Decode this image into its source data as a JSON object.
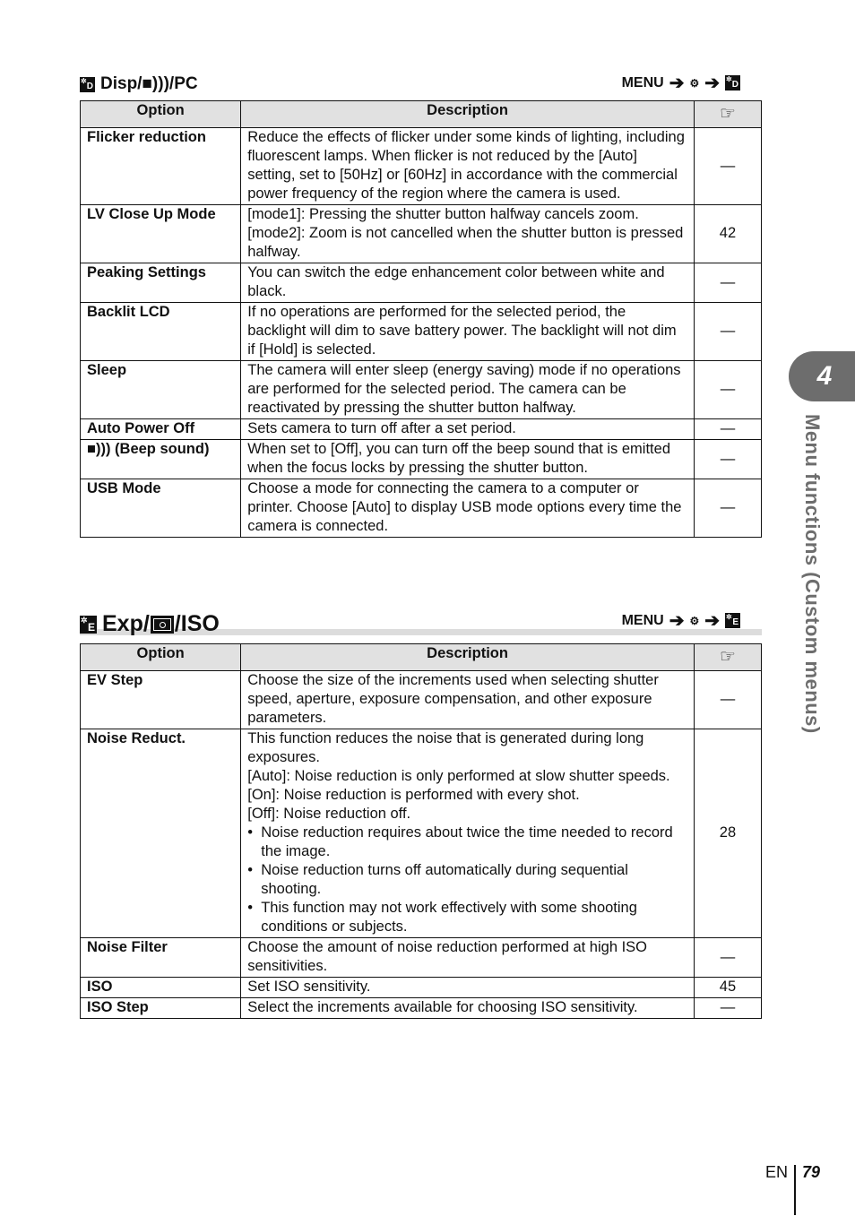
{
  "section1": {
    "title": "Disp/■)))/PC",
    "icon": "custom-menu-d-icon",
    "menu_path": {
      "menu": "MENU",
      "arrow": "➔",
      "gear": "⚙",
      "icon_letter": "D"
    },
    "headers": {
      "option": "Option",
      "description": "Description",
      "ref": "☞"
    },
    "rows": [
      {
        "option": "Flicker reduction",
        "description": [
          "Reduce the effects of flicker under some kinds of lighting, including fluorescent lamps. When flicker is not reduced by the [Auto] setting, set to [50Hz] or [60Hz] in accordance with the commercial power frequency of the region where the camera is used."
        ],
        "ref": "—"
      },
      {
        "option": "LV Close Up Mode",
        "description": [
          "[mode1]: Pressing the shutter button halfway cancels zoom.",
          "[mode2]: Zoom is not cancelled when the shutter button is pressed halfway."
        ],
        "ref": "42"
      },
      {
        "option": "Peaking Settings",
        "description": [
          "You can switch the edge enhancement color between white and black."
        ],
        "ref": "—"
      },
      {
        "option": "Backlit LCD",
        "description": [
          "If no operations are performed for the selected period, the backlight will dim to save battery power. The backlight will not dim if [Hold] is selected."
        ],
        "ref": "—"
      },
      {
        "option": "Sleep",
        "description": [
          "The camera will enter sleep (energy saving) mode if no operations are performed for the selected period. The camera can be reactivated by pressing the shutter button halfway."
        ],
        "ref": "—"
      },
      {
        "option": "Auto Power Off",
        "description": [
          "Sets camera to turn off after a set period."
        ],
        "ref": "—"
      },
      {
        "option": "■))) (Beep sound)",
        "description": [
          "When set to [Off], you can turn off the beep sound that is emitted when the focus locks by pressing the shutter button."
        ],
        "ref": "—"
      },
      {
        "option": "USB Mode",
        "description": [
          "Choose a mode for connecting the camera to a computer or printer. Choose [Auto] to display USB mode options every time the camera is connected."
        ],
        "ref": "—"
      }
    ]
  },
  "section2": {
    "title_a": "Exp/",
    "title_b": "/ISO",
    "icon": "custom-menu-e-icon",
    "menu_path": {
      "menu": "MENU",
      "arrow": "➔",
      "gear": "⚙",
      "icon_letter": "E"
    },
    "headers": {
      "option": "Option",
      "description": "Description",
      "ref": "☞"
    },
    "rows": [
      {
        "option": "EV Step",
        "description": [
          "Choose the size of the increments used when selecting shutter speed, aperture, exposure compensation, and other exposure parameters."
        ],
        "ref": "—"
      },
      {
        "option": "Noise Reduct.",
        "description": [
          "This function reduces the noise that is generated during long exposures.",
          "[Auto]: Noise reduction is only performed at slow shutter speeds.",
          "[On]: Noise reduction is performed with every shot.",
          "[Off]: Noise reduction off."
        ],
        "bullets": [
          "Noise reduction requires about twice the time needed to record the image.",
          "Noise reduction turns off automatically during sequential shooting.",
          "This function may not work effectively with some shooting conditions or subjects."
        ],
        "ref": "28"
      },
      {
        "option": "Noise Filter",
        "description": [
          "Choose the amount of noise reduction performed at high ISO sensitivities."
        ],
        "ref": "—"
      },
      {
        "option": "ISO",
        "description": [
          "Set ISO sensitivity."
        ],
        "ref": "45"
      },
      {
        "option": "ISO Step",
        "description": [
          "Select the increments available for choosing ISO sensitivity."
        ],
        "ref": "—"
      }
    ]
  },
  "side_tab": {
    "chapter": "4",
    "label": "Menu functions (Custom menus)"
  },
  "footer": {
    "lang": "EN",
    "page": "79"
  }
}
